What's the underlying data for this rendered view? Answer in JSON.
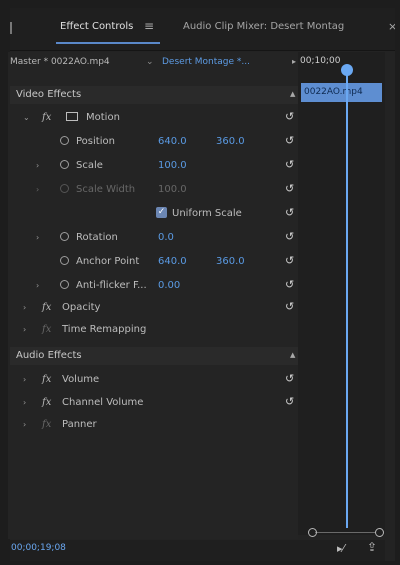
{
  "tabs": {
    "effect_controls": "Effect Controls",
    "effect_controls_menu": "≡",
    "audio_mixer": "Audio Clip Mixer: Desert Montag",
    "close": "×"
  },
  "clip_selector": {
    "master": "Master * 0022AO.mp4",
    "arrow": "⌄",
    "sequence": "Desert Montage *...",
    "play": "▸"
  },
  "timeline": {
    "time_label": "00;10;00",
    "clip_name": "0022AO.mp4"
  },
  "video_section": {
    "label": "Video Effects",
    "caret": "▲",
    "motion": "Motion",
    "position": {
      "label": "Position",
      "x": "640.0",
      "y": "360.0"
    },
    "scale": {
      "label": "Scale",
      "value": "100.0"
    },
    "scale_width": {
      "label": "Scale Width",
      "value": "100.0"
    },
    "uniform": {
      "label": "Uniform Scale",
      "check": "✓"
    },
    "rotation": {
      "label": "Rotation",
      "value": "0.0"
    },
    "anchor": {
      "label": "Anchor Point",
      "x": "640.0",
      "y": "360.0"
    },
    "anti": {
      "label": "Anti-flicker F...",
      "value": "0.00"
    },
    "opacity": "Opacity",
    "time_remap": "Time Remapping"
  },
  "audio_section": {
    "label": "Audio Effects",
    "caret": "▲",
    "volume": "Volume",
    "channel_volume": "Channel Volume",
    "panner": "Panner"
  },
  "fx_glyph": "fx",
  "reset_glyph": "↺",
  "twist_open": "⌄",
  "twist_closed": "›",
  "footer": {
    "timecode": "00;00;19;08",
    "filter_icon": "▸⁄",
    "export_icon": "⇪"
  }
}
